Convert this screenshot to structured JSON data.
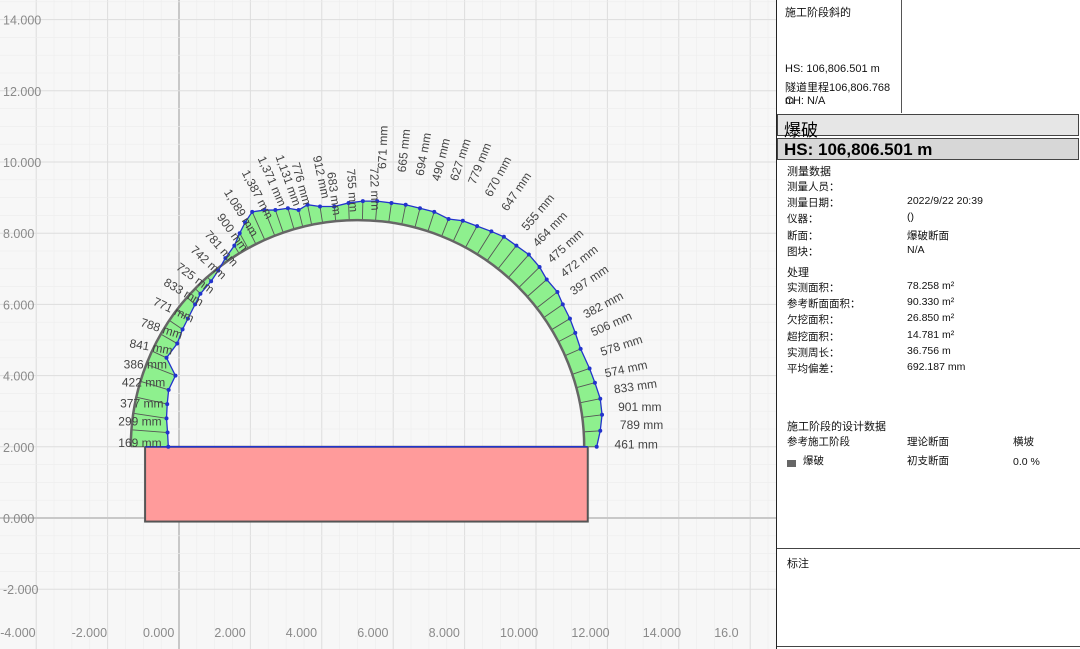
{
  "chart_data": {
    "type": "scatter",
    "xlim": [
      -4.6,
      16.3
    ],
    "ylim": [
      -3.4,
      14.5
    ],
    "x_ticks": [
      "-4.000",
      "-2.000",
      "0.000",
      "2.000",
      "4.000",
      "6.000",
      "8.000",
      "10.000",
      "12.000",
      "14.000",
      "16.0"
    ],
    "x_tick_values": [
      -4,
      -2,
      0,
      2,
      4,
      6,
      8,
      10,
      12,
      14,
      16
    ],
    "y_ticks": [
      "14.000",
      "12.000",
      "10.000",
      "8.000",
      "6.000",
      "4.000",
      "2.000",
      "0.000",
      "-2.000"
    ],
    "y_tick_values": [
      14,
      12,
      10,
      8,
      6,
      4,
      2,
      0,
      -2
    ],
    "design_arch": {
      "center_x": 5.0,
      "center_y": 2.0,
      "radius": 6.35,
      "floor_y": -0.1
    },
    "measured_profile": [
      [
        -0.3,
        2.0
      ],
      [
        -0.32,
        2.4
      ],
      [
        -0.35,
        2.8
      ],
      [
        -0.33,
        3.2
      ],
      [
        -0.29,
        3.6
      ],
      [
        -0.1,
        4.0
      ],
      [
        -0.35,
        4.5
      ],
      [
        -0.05,
        4.9
      ],
      [
        0.1,
        5.3
      ],
      [
        0.25,
        5.6
      ],
      [
        0.45,
        6.0
      ],
      [
        0.6,
        6.3
      ],
      [
        0.9,
        6.65
      ],
      [
        1.1,
        6.95
      ],
      [
        1.3,
        7.3
      ],
      [
        1.55,
        7.65
      ],
      [
        1.7,
        8.0
      ],
      [
        1.85,
        8.3
      ],
      [
        2.05,
        8.6
      ],
      [
        2.4,
        8.65
      ],
      [
        2.7,
        8.65
      ],
      [
        3.05,
        8.7
      ],
      [
        3.35,
        8.65
      ],
      [
        3.6,
        8.8
      ],
      [
        3.95,
        8.75
      ],
      [
        4.35,
        8.75
      ],
      [
        4.75,
        8.85
      ],
      [
        5.15,
        8.9
      ],
      [
        5.55,
        8.9
      ],
      [
        5.95,
        8.85
      ],
      [
        6.35,
        8.8
      ],
      [
        6.75,
        8.7
      ],
      [
        7.15,
        8.6
      ],
      [
        7.55,
        8.4
      ],
      [
        7.95,
        8.35
      ],
      [
        8.35,
        8.2
      ],
      [
        8.75,
        8.05
      ],
      [
        9.1,
        7.9
      ],
      [
        9.45,
        7.65
      ],
      [
        9.8,
        7.4
      ],
      [
        10.1,
        7.05
      ],
      [
        10.3,
        6.7
      ],
      [
        10.6,
        6.35
      ],
      [
        10.75,
        6.0
      ],
      [
        10.95,
        5.6
      ],
      [
        11.1,
        5.2
      ],
      [
        11.25,
        4.75
      ],
      [
        11.5,
        4.2
      ],
      [
        11.65,
        3.8
      ],
      [
        11.8,
        3.35
      ],
      [
        11.85,
        2.9
      ],
      [
        11.8,
        2.45
      ],
      [
        11.7,
        2.0
      ]
    ],
    "profile_color": "#2233cc",
    "overbreak_color": "#8ef08e",
    "floor_rect": {
      "x0": -0.95,
      "x1": 11.45,
      "y0": -0.1,
      "y1": 2.0
    },
    "floor_color": "#ff9b9b",
    "deviation_labels": [
      {
        "text": "169 mm",
        "x": -1.7,
        "y": 2.0,
        "angle": 0
      },
      {
        "text": "299 mm",
        "x": -1.7,
        "y": 2.6,
        "angle": 0
      },
      {
        "text": "377 mm",
        "x": -1.65,
        "y": 3.1,
        "angle": 0
      },
      {
        "text": "422 mm",
        "x": -1.6,
        "y": 3.7,
        "angle": 0
      },
      {
        "text": "386 mm",
        "x": -1.55,
        "y": 4.2,
        "angle": 0
      },
      {
        "text": "841 mm",
        "x": -1.4,
        "y": 4.8,
        "angle": 10
      },
      {
        "text": "788 mm",
        "x": -1.1,
        "y": 5.4,
        "angle": 18
      },
      {
        "text": "771 mm",
        "x": -0.75,
        "y": 6.0,
        "angle": 25
      },
      {
        "text": "833 mm",
        "x": -0.45,
        "y": 6.55,
        "angle": 30
      },
      {
        "text": "725 mm",
        "x": -0.1,
        "y": 7.0,
        "angle": 36
      },
      {
        "text": "742 mm",
        "x": 0.3,
        "y": 7.5,
        "angle": 42
      },
      {
        "text": "781 mm",
        "x": 0.7,
        "y": 7.95,
        "angle": 48
      },
      {
        "text": "900 mm",
        "x": 1.05,
        "y": 8.45,
        "angle": 54
      },
      {
        "text": "1,089 mm",
        "x": 1.25,
        "y": 9.15,
        "angle": 58
      },
      {
        "text": "1,387 mm",
        "x": 1.75,
        "y": 9.7,
        "angle": 62
      },
      {
        "text": "1,371 mm",
        "x": 2.2,
        "y": 10.1,
        "angle": 66
      },
      {
        "text": "1,131 mm",
        "x": 2.7,
        "y": 10.15,
        "angle": 70
      },
      {
        "text": "776 mm",
        "x": 3.15,
        "y": 9.95,
        "angle": 74
      },
      {
        "text": "912 mm",
        "x": 3.75,
        "y": 10.15,
        "angle": 78
      },
      {
        "text": "683 mm",
        "x": 4.15,
        "y": 9.7,
        "angle": 82
      },
      {
        "text": "755 mm",
        "x": 4.7,
        "y": 9.8,
        "angle": 86
      },
      {
        "text": "722 mm",
        "x": 5.35,
        "y": 9.85,
        "angle": 88
      },
      {
        "text": "671 mm",
        "x": 5.8,
        "y": 9.8,
        "angle": -88
      },
      {
        "text": "665 mm",
        "x": 6.35,
        "y": 9.7,
        "angle": -84
      },
      {
        "text": "694 mm",
        "x": 6.85,
        "y": 9.6,
        "angle": -80
      },
      {
        "text": "490 mm",
        "x": 7.3,
        "y": 9.45,
        "angle": -76
      },
      {
        "text": "627 mm",
        "x": 7.8,
        "y": 9.45,
        "angle": -72
      },
      {
        "text": "779 mm",
        "x": 8.3,
        "y": 9.35,
        "angle": -68
      },
      {
        "text": "670 mm",
        "x": 8.75,
        "y": 9.0,
        "angle": -62
      },
      {
        "text": "647 mm",
        "x": 9.2,
        "y": 8.6,
        "angle": -56
      },
      {
        "text": "555 mm",
        "x": 9.75,
        "y": 8.05,
        "angle": -50
      },
      {
        "text": "464 mm",
        "x": 10.05,
        "y": 7.6,
        "angle": -46
      },
      {
        "text": "475 mm",
        "x": 10.45,
        "y": 7.15,
        "angle": -42
      },
      {
        "text": "472 mm",
        "x": 10.8,
        "y": 6.75,
        "angle": -38
      },
      {
        "text": "397 mm",
        "x": 11.05,
        "y": 6.25,
        "angle": -34
      },
      {
        "text": "382 mm",
        "x": 11.4,
        "y": 5.6,
        "angle": -28
      },
      {
        "text": "506 mm",
        "x": 11.6,
        "y": 5.1,
        "angle": -24
      },
      {
        "text": "578 mm",
        "x": 11.85,
        "y": 4.55,
        "angle": -18
      },
      {
        "text": "574 mm",
        "x": 11.95,
        "y": 3.95,
        "angle": -12
      },
      {
        "text": "833 mm",
        "x": 12.2,
        "y": 3.5,
        "angle": -8
      },
      {
        "text": "901 mm",
        "x": 12.3,
        "y": 3.0,
        "angle": 0
      },
      {
        "text": "789 mm",
        "x": 12.35,
        "y": 2.5,
        "angle": 0
      },
      {
        "text": "461 mm",
        "x": 12.2,
        "y": 1.95,
        "angle": 0
      }
    ]
  },
  "panel": {
    "stage_label": "施工阶段斜的",
    "hs_line": "HS:  106,806.501 m",
    "tunnel_line": "隧道里程106,806.768 m",
    "ch_line": "CH:  N/A",
    "bar_title": "爆破",
    "bar_hs": "HS: 106,806.501 m",
    "measure_section": "测量数据",
    "measure_rows": [
      {
        "label": "测量人员：",
        "value": ""
      },
      {
        "label": "测量日期：",
        "value": "2022/9/22 20:39"
      },
      {
        "label": "仪器：",
        "value": "()"
      },
      {
        "label": "断面：",
        "value": "爆破断面"
      },
      {
        "label": "图块：",
        "value": "N/A"
      }
    ],
    "process_section": "处理",
    "process_rows": [
      {
        "label": "实测面积：",
        "value": "78.258 m²"
      },
      {
        "label": "参考断面面积：",
        "value": "90.330 m²"
      },
      {
        "label": "欠挖面积：",
        "value": "26.850 m²"
      },
      {
        "label": "超挖面积：",
        "value": "14.781 m²"
      },
      {
        "label": "实测周长：",
        "value": "36.756 m"
      },
      {
        "label": "平均偏差：",
        "value": "692.187 mm"
      }
    ],
    "design_section": "施工阶段的设计数据",
    "design_headers": [
      "参考施工阶段",
      "理论断面",
      "横坡"
    ],
    "design_row": [
      "爆破",
      "初支断面",
      "0.0 %"
    ],
    "notes_label": "标注"
  }
}
